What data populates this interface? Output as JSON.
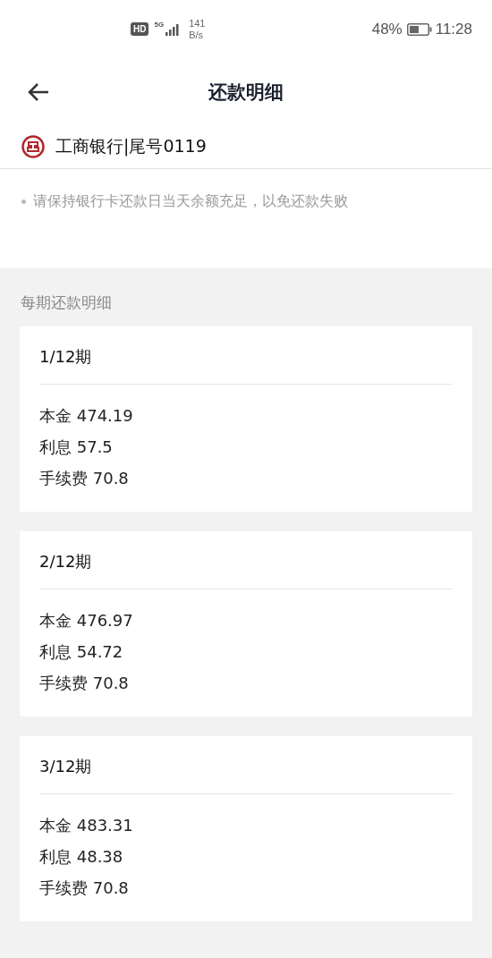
{
  "status_bar": {
    "network_badge": "HD",
    "network_type": "5G",
    "speed_value": "141",
    "speed_unit": "B/s",
    "battery": "48%",
    "time": "11:28"
  },
  "header": {
    "title": "还款明细"
  },
  "bank_card": {
    "label": "工商银行|尾号0119"
  },
  "notes": [
    "请保持银行卡还款日当天余额充足，以免还款失败"
  ],
  "section_title": "每期还款明细",
  "periods": [
    {
      "title": "1/12期",
      "lines": [
        "本金 474.19",
        "利息 57.5",
        "手续费 70.8"
      ]
    },
    {
      "title": "2/12期",
      "lines": [
        "本金 476.97",
        "利息 54.72",
        "手续费 70.8"
      ]
    },
    {
      "title": "3/12期",
      "lines": [
        "本金 483.31",
        "利息 48.38",
        "手续费 70.8"
      ]
    }
  ]
}
